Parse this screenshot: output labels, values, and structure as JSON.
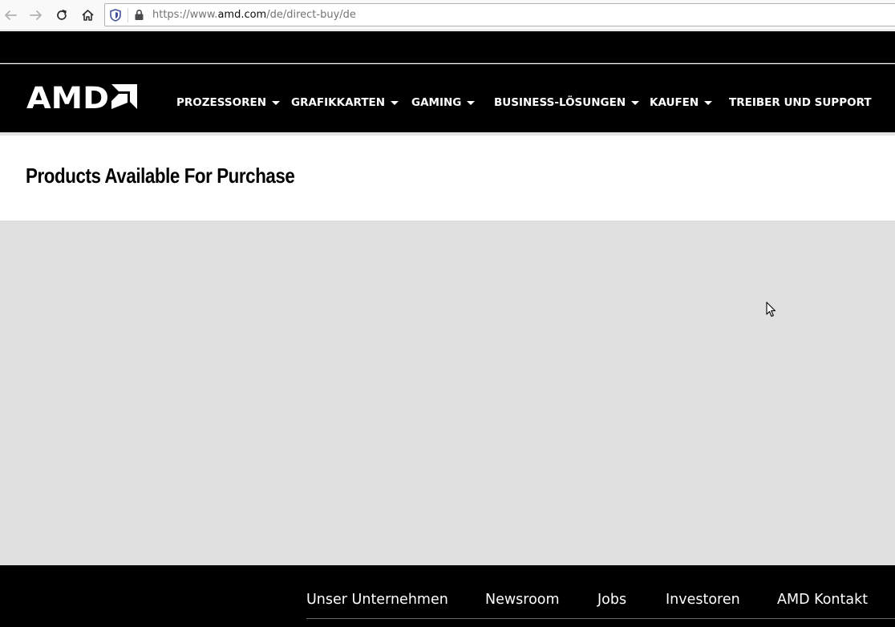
{
  "browser": {
    "url_prefix": "https://www.",
    "url_domain": "amd.com",
    "url_path": "/de/direct-buy/de",
    "icons": [
      "back-arrow-icon",
      "forward-arrow-icon",
      "reload-icon",
      "home-icon",
      "tracking-shield-icon",
      "lock-icon"
    ]
  },
  "header": {
    "logo_text": "AMD",
    "nav": [
      {
        "label": "PROZESSOREN",
        "has_dropdown": true
      },
      {
        "label": "GRAFIKKARTEN",
        "has_dropdown": true
      },
      {
        "label": "GAMING",
        "has_dropdown": true
      },
      {
        "label": "BUSINESS-LÖSUNGEN",
        "has_dropdown": true
      },
      {
        "label": "KAUFEN",
        "has_dropdown": true
      },
      {
        "label": "TREIBER UND SUPPORT",
        "has_dropdown": false
      }
    ]
  },
  "main": {
    "title": "Products Available For Purchase"
  },
  "footer": {
    "links": [
      "Unser Unternehmen",
      "Newsroom",
      "Jobs",
      "Investoren",
      "AMD Kontakt"
    ]
  },
  "colors": {
    "header_bg": "#000000",
    "content_bg": "#e0e0e0",
    "text_light": "#ffffff"
  }
}
